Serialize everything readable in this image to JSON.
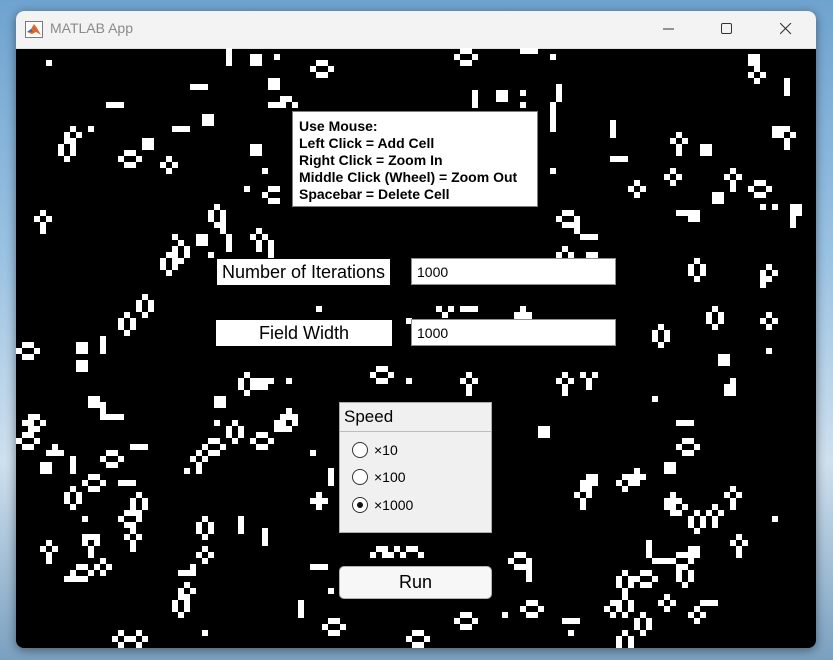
{
  "window": {
    "title": "MATLAB App",
    "icon": "matlab-logo-icon",
    "controls": [
      "minimize-icon",
      "maximize-icon",
      "close-icon"
    ]
  },
  "help": {
    "lines": [
      "Use Mouse:",
      "Left Click = Add Cell",
      "Right Click = Zoom In",
      "Middle Click (Wheel) = Zoom Out",
      "Spacebar = Delete Cell"
    ]
  },
  "iterations": {
    "label": "Number of Iterations",
    "value": "1000"
  },
  "field_width": {
    "label": "Field Width",
    "value": "1000"
  },
  "speed": {
    "title": "Speed",
    "options": [
      "×10",
      "×100",
      "×1000"
    ],
    "selected": "×1000"
  },
  "run": {
    "label": "Run"
  },
  "colors": {
    "canvas": "#000000",
    "cell": "#ffffff",
    "panel": "#f0f0f0"
  }
}
